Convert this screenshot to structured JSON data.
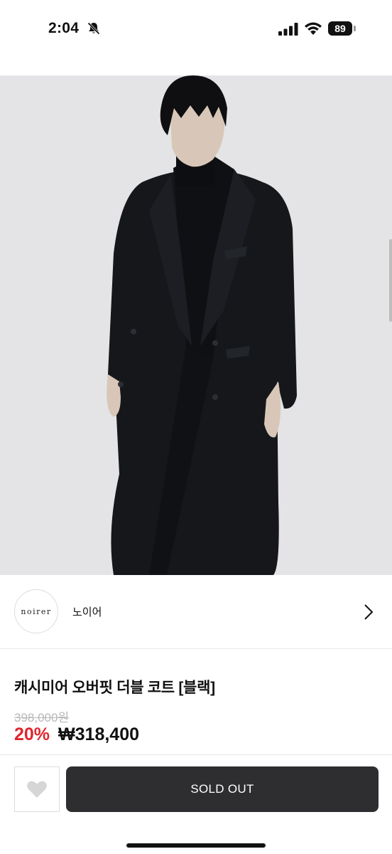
{
  "status_bar": {
    "time": "2:04",
    "battery": "89",
    "icons": [
      "bell-slash-icon",
      "cellular-signal-icon",
      "wifi-icon",
      "battery-icon"
    ]
  },
  "product_image": {
    "colors": {
      "background": "#e4e4e6",
      "coat": "#15171b"
    }
  },
  "brand": {
    "logo_text": "noirer",
    "name": "노이어"
  },
  "product": {
    "title": "캐시미어 오버핏 더블 코트 [블랙]",
    "original_price": "398,000원",
    "discount": "20%",
    "sale_price": "₩318,400"
  },
  "actions": {
    "wish_icon": "heart-icon",
    "soldout_label": "SOLD OUT"
  },
  "colors": {
    "discount": "#e0262e",
    "button": "#2e2e30"
  }
}
